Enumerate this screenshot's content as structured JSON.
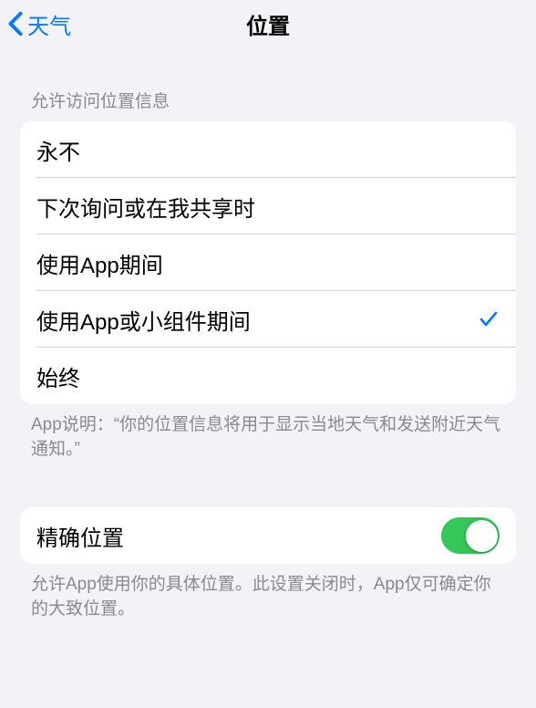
{
  "header": {
    "back_label": "天气",
    "title": "位置"
  },
  "allow_section": {
    "header": "允许访问位置信息",
    "options": [
      {
        "label": "永不",
        "selected": false
      },
      {
        "label": "下次询问或在我共享时",
        "selected": false
      },
      {
        "label": "使用App期间",
        "selected": false
      },
      {
        "label": "使用App或小组件期间",
        "selected": true
      },
      {
        "label": "始终",
        "selected": false
      }
    ],
    "footer": "App说明：“你的位置信息将用于显示当地天气和发送附近天气通知。”"
  },
  "precise_section": {
    "label": "精确位置",
    "enabled": true,
    "footer": "允许App使用你的具体位置。此设置关闭时，App仅可确定你的大致位置。"
  }
}
